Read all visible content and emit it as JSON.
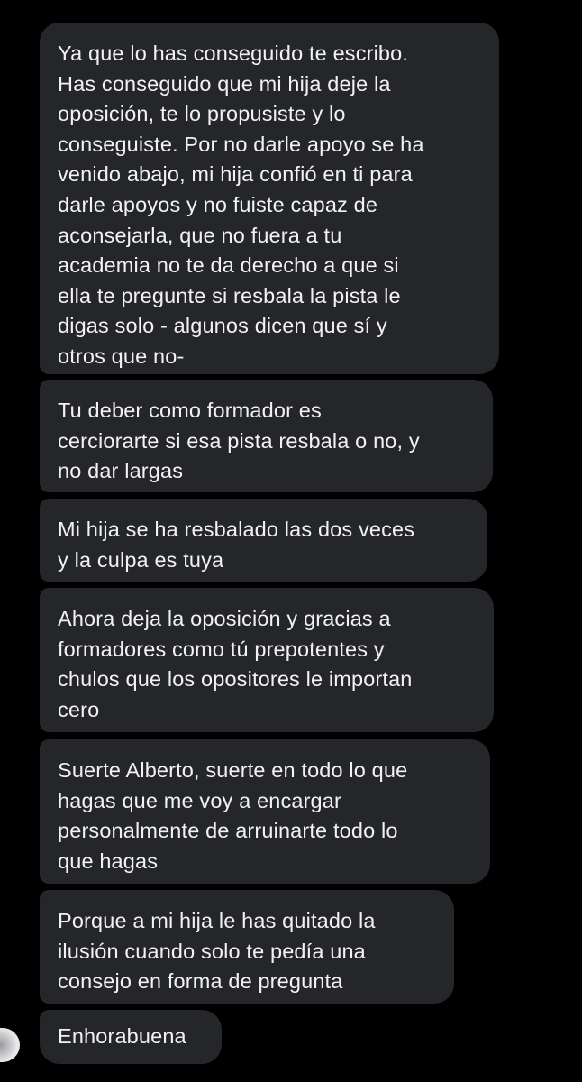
{
  "conversation": {
    "messages": [
      {
        "text": "Ya que lo has conseguido te escribo.\nHas conseguido que mi hija deje la\noposición, te lo propusiste y lo\nconseguiste. Por no darle apoyo se ha\nvenido abajo, mi hija confió en ti para\ndarle apoyos y no fuiste capaz de\naconsejarla, que no fuera a tu\nacademia no te da derecho a que si\nella te pregunte si resbala la pista le\ndigas solo - algunos dicen que sí y\notros que no-"
      },
      {
        "text": "Tu deber como formador es\ncerciorarte si esa pista resbala o no, y\nno dar largas"
      },
      {
        "text": "Mi hija se ha resbalado las dos veces\ny la culpa es tuya"
      },
      {
        "text": "Ahora deja la oposición y gracias a\nformadores como tú prepotentes y\nchulos que los opositores le importan\ncero"
      },
      {
        "text": "Suerte Alberto, suerte en todo lo que\nhagas que me voy a encargar\npersonalmente de arruinarte todo lo\nque hagas"
      },
      {
        "text": "Porque a mi hija le has quitado la\nilusión cuando solo te pedía una\nconsejo en forma de pregunta"
      },
      {
        "text": "Enhorabuena"
      }
    ]
  },
  "colors": {
    "background": "#000000",
    "bubble": "#252629",
    "text": "#f2f2f4"
  },
  "icons": {
    "sender_avatar": "avatar"
  }
}
